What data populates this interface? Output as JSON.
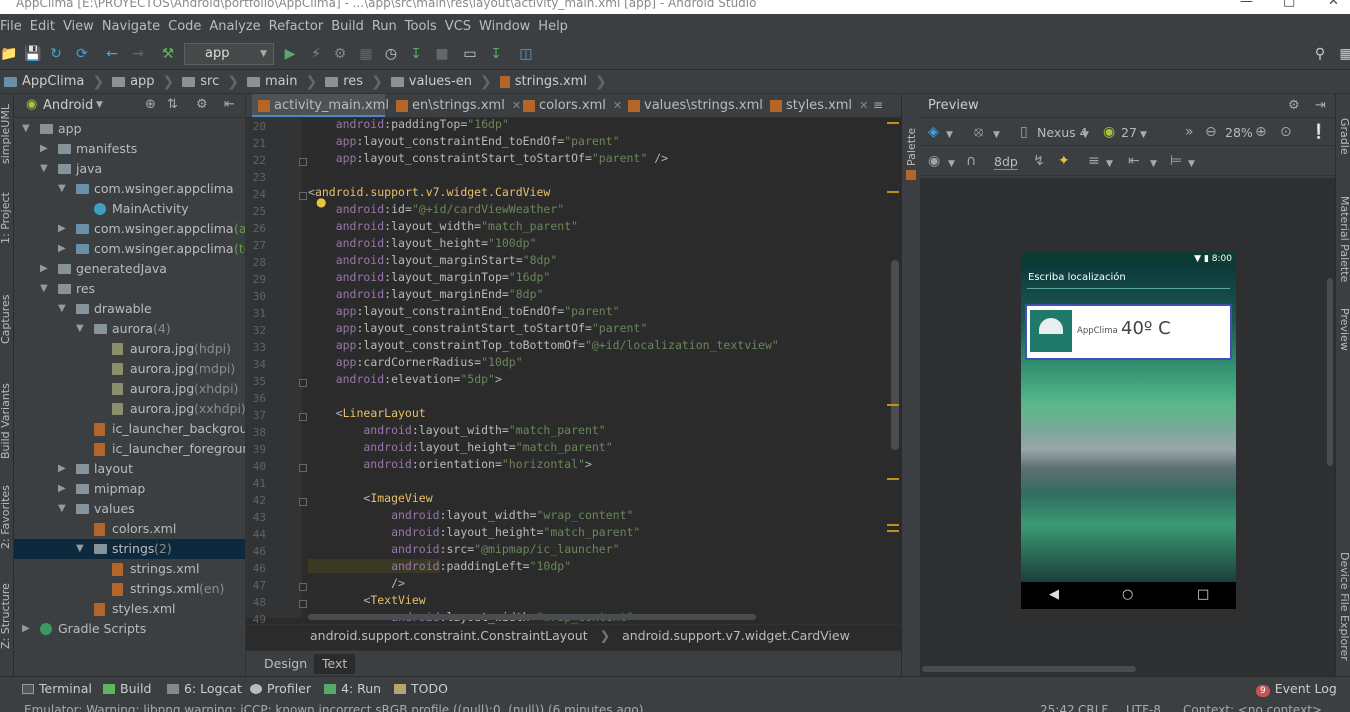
{
  "window": {
    "title": "AppClima [E:\\PROYECTOS\\Android\\portfolio\\AppClima] - ...\\app\\src\\main\\res\\layout\\activity_main.xml [app] - Android Studio"
  },
  "menu": [
    "File",
    "Edit",
    "View",
    "Navigate",
    "Code",
    "Analyze",
    "Refactor",
    "Build",
    "Run",
    "Tools",
    "VCS",
    "Window",
    "Help"
  ],
  "toolbar": {
    "config": "app"
  },
  "breadcrumb": [
    "AppClima",
    "app",
    "src",
    "main",
    "res",
    "values-en",
    "strings.xml"
  ],
  "left_strip": [
    "1: Project",
    "Captures",
    "Build Variants",
    "2: Favorites",
    "Z: Structure",
    "simpleUML"
  ],
  "project": {
    "view_mode": "Android",
    "tree": [
      {
        "label": "app",
        "indent": 0,
        "arrow": "▼",
        "icon": "folder"
      },
      {
        "label": "manifests",
        "indent": 1,
        "arrow": "▶",
        "icon": "folder"
      },
      {
        "label": "java",
        "indent": 1,
        "arrow": "▼",
        "icon": "folder"
      },
      {
        "label": "com.wsinger.appclima",
        "indent": 2,
        "arrow": "▼",
        "icon": "pkg"
      },
      {
        "label": "MainActivity",
        "indent": 3,
        "arrow": "",
        "icon": "cls"
      },
      {
        "label": "com.wsinger.appclima",
        "suffix": " (andro",
        "indent": 2,
        "arrow": "▶",
        "icon": "pkg"
      },
      {
        "label": "com.wsinger.appclima",
        "suffix": " (test)",
        "indent": 2,
        "arrow": "▶",
        "icon": "pkg"
      },
      {
        "label": "generatedJava",
        "indent": 1,
        "arrow": "▶",
        "icon": "folder"
      },
      {
        "label": "res",
        "indent": 1,
        "arrow": "▼",
        "icon": "folder"
      },
      {
        "label": "drawable",
        "indent": 2,
        "arrow": "▼",
        "icon": "folder"
      },
      {
        "label": "aurora",
        "suffix": " (4)",
        "indent": 3,
        "arrow": "▼",
        "icon": "folder"
      },
      {
        "label": "aurora.jpg",
        "suffix": " (hdpi)",
        "indent": 4,
        "arrow": "",
        "icon": "img"
      },
      {
        "label": "aurora.jpg",
        "suffix": " (mdpi)",
        "indent": 4,
        "arrow": "",
        "icon": "img"
      },
      {
        "label": "aurora.jpg",
        "suffix": " (xhdpi)",
        "indent": 4,
        "arrow": "",
        "icon": "img"
      },
      {
        "label": "aurora.jpg",
        "suffix": " (xxhdpi)",
        "indent": 4,
        "arrow": "",
        "icon": "img"
      },
      {
        "label": "ic_launcher_background.x",
        "indent": 3,
        "arrow": "",
        "icon": "xml"
      },
      {
        "label": "ic_launcher_foreground.xr",
        "indent": 3,
        "arrow": "",
        "icon": "xml"
      },
      {
        "label": "layout",
        "indent": 2,
        "arrow": "▶",
        "icon": "folder"
      },
      {
        "label": "mipmap",
        "indent": 2,
        "arrow": "▶",
        "icon": "folder"
      },
      {
        "label": "values",
        "indent": 2,
        "arrow": "▼",
        "icon": "folder"
      },
      {
        "label": "colors.xml",
        "indent": 3,
        "arrow": "",
        "icon": "xml"
      },
      {
        "label": "strings",
        "suffix": " (2)",
        "indent": 3,
        "arrow": "▼",
        "icon": "folder",
        "selected": true
      },
      {
        "label": "strings.xml",
        "indent": 4,
        "arrow": "",
        "icon": "xml"
      },
      {
        "label": "strings.xml",
        "suffix": " (en)",
        "indent": 4,
        "arrow": "",
        "icon": "xml"
      },
      {
        "label": "styles.xml",
        "indent": 3,
        "arrow": "",
        "icon": "xml"
      },
      {
        "label": "Gradle Scripts",
        "indent": 0,
        "arrow": "▶",
        "icon": "grd"
      }
    ]
  },
  "editor": {
    "tabs": [
      "activity_main.xml",
      "en\\strings.xml",
      "colors.xml",
      "values\\strings.xml",
      "styles.xml"
    ],
    "active_tab": 0,
    "lines": [
      {
        "n": "20",
        "parts": [
          [
            "ns",
            "    android"
          ],
          [
            "at",
            ":paddingTop="
          ],
          [
            "st",
            "\"16dp\""
          ]
        ]
      },
      {
        "n": "21",
        "parts": [
          [
            "ns",
            "    app"
          ],
          [
            "at",
            ":layout_constraintEnd_toEndOf="
          ],
          [
            "st",
            "\"parent\""
          ]
        ]
      },
      {
        "n": "22",
        "parts": [
          [
            "ns",
            "    app"
          ],
          [
            "at",
            ":layout_constraintStart_toStartOf="
          ],
          [
            "st",
            "\"parent\""
          ],
          [
            "pu",
            " />"
          ]
        ]
      },
      {
        "n": "23",
        "parts": []
      },
      {
        "n": "24",
        "parts": [
          [
            "pu",
            "<"
          ],
          [
            "tg",
            "android.support.v7.widget.CardView"
          ]
        ]
      },
      {
        "n": "25",
        "parts": [
          [
            "ns",
            "    android"
          ],
          [
            "at",
            ":id="
          ],
          [
            "st",
            "\"@+id/cardViewWeather\""
          ]
        ]
      },
      {
        "n": "26",
        "parts": [
          [
            "ns",
            "    android"
          ],
          [
            "at",
            ":layout_width="
          ],
          [
            "st",
            "\"match_parent\""
          ]
        ]
      },
      {
        "n": "27",
        "parts": [
          [
            "ns",
            "    android"
          ],
          [
            "at",
            ":layout_height="
          ],
          [
            "st",
            "\"100dp\""
          ]
        ]
      },
      {
        "n": "28",
        "parts": [
          [
            "ns",
            "    android"
          ],
          [
            "at",
            ":layout_marginStart="
          ],
          [
            "st",
            "\"8dp\""
          ]
        ]
      },
      {
        "n": "29",
        "parts": [
          [
            "ns",
            "    android"
          ],
          [
            "at",
            ":layout_marginTop="
          ],
          [
            "st",
            "\"16dp\""
          ]
        ]
      },
      {
        "n": "30",
        "parts": [
          [
            "ns",
            "    android"
          ],
          [
            "at",
            ":layout_marginEnd="
          ],
          [
            "st",
            "\"8dp\""
          ]
        ]
      },
      {
        "n": "31",
        "parts": [
          [
            "ns",
            "    app"
          ],
          [
            "at",
            ":layout_constraintEnd_toEndOf="
          ],
          [
            "st",
            "\"parent\""
          ]
        ]
      },
      {
        "n": "32",
        "parts": [
          [
            "ns",
            "    app"
          ],
          [
            "at",
            ":layout_constraintStart_toStartOf="
          ],
          [
            "st",
            "\"parent\""
          ]
        ]
      },
      {
        "n": "33",
        "parts": [
          [
            "ns",
            "    app"
          ],
          [
            "at",
            ":layout_constraintTop_toBottomOf="
          ],
          [
            "st",
            "\"@+id/localization_textview\""
          ]
        ]
      },
      {
        "n": "34",
        "parts": [
          [
            "ns",
            "    app"
          ],
          [
            "at",
            ":cardCornerRadius="
          ],
          [
            "st",
            "\"10dp\""
          ]
        ]
      },
      {
        "n": "35",
        "parts": [
          [
            "ns",
            "    android"
          ],
          [
            "at",
            ":elevation="
          ],
          [
            "st",
            "\"5dp\""
          ],
          [
            "pu",
            ">"
          ]
        ]
      },
      {
        "n": "36",
        "parts": []
      },
      {
        "n": "37",
        "parts": [
          [
            "pu",
            "    <"
          ],
          [
            "tg",
            "LinearLayout"
          ]
        ]
      },
      {
        "n": "38",
        "parts": [
          [
            "ns",
            "        android"
          ],
          [
            "at",
            ":layout_width="
          ],
          [
            "st",
            "\"match_parent\""
          ]
        ]
      },
      {
        "n": "39",
        "parts": [
          [
            "ns",
            "        android"
          ],
          [
            "at",
            ":layout_height="
          ],
          [
            "st",
            "\"match_parent\""
          ]
        ]
      },
      {
        "n": "40",
        "parts": [
          [
            "ns",
            "        android"
          ],
          [
            "at",
            ":orientation="
          ],
          [
            "st",
            "\"horizontal\""
          ],
          [
            "pu",
            ">"
          ]
        ]
      },
      {
        "n": "41",
        "parts": []
      },
      {
        "n": "42",
        "parts": [
          [
            "pu",
            "        <"
          ],
          [
            "tg",
            "ImageView"
          ]
        ]
      },
      {
        "n": "43",
        "parts": [
          [
            "ns",
            "            android"
          ],
          [
            "at",
            ":layout_width="
          ],
          [
            "st",
            "\"wrap_content\""
          ]
        ]
      },
      {
        "n": "44",
        "parts": [
          [
            "ns",
            "            android"
          ],
          [
            "at",
            ":layout_height="
          ],
          [
            "st",
            "\"match_parent\""
          ]
        ]
      },
      {
        "n": "46",
        "parts": [
          [
            "ns",
            "            android"
          ],
          [
            "at",
            ":src="
          ],
          [
            "st",
            "\"@mipmap/ic_launcher\""
          ]
        ]
      },
      {
        "n": "46",
        "parts": [
          [
            "ns",
            "            android"
          ],
          [
            "at",
            ":paddingLeft="
          ],
          [
            "st",
            "\"10dp\""
          ]
        ]
      },
      {
        "n": "47",
        "parts": [
          [
            "pu",
            "            />"
          ]
        ]
      },
      {
        "n": "48",
        "parts": [
          [
            "pu",
            "        <"
          ],
          [
            "tg",
            "TextView"
          ]
        ]
      },
      {
        "n": "49",
        "parts": [
          [
            "ns",
            "            android"
          ],
          [
            "at",
            ":layout_width="
          ],
          [
            "st",
            "\"wrap_content\""
          ]
        ]
      }
    ],
    "bottom_breadcrumb": [
      "android.support.constraint.ConstraintLayout",
      "android.support.v7.widget.CardView"
    ],
    "view_tabs": [
      "Design",
      "Text"
    ],
    "active_view_tab": 1
  },
  "preview": {
    "title": "Preview",
    "device": "Nexus 4",
    "api": "27",
    "zoom": "28%",
    "margin": "8dp",
    "phone": {
      "time": "8:00",
      "hint": "Escriba localización",
      "app_name": "AppClima",
      "temperature": "40º C"
    }
  },
  "right_strip": [
    "Gradle",
    "Palette",
    "Material Palette",
    "Preview",
    "Device File Explorer"
  ],
  "toolwindows": [
    "Terminal",
    "Build",
    "6: Logcat",
    "Profiler",
    "4: Run",
    "TODO"
  ],
  "event_log": {
    "count": "9",
    "label": "Event Log"
  },
  "status": {
    "message": "Emulator: Warning: libpng warning: iCCP: known incorrect sRGB profile ((null):0, (null)) (6 minutes ago)",
    "position": "25:42",
    "line_sep": "CRLF",
    "encoding": "UTF-8",
    "context": "Context: <no context>"
  }
}
